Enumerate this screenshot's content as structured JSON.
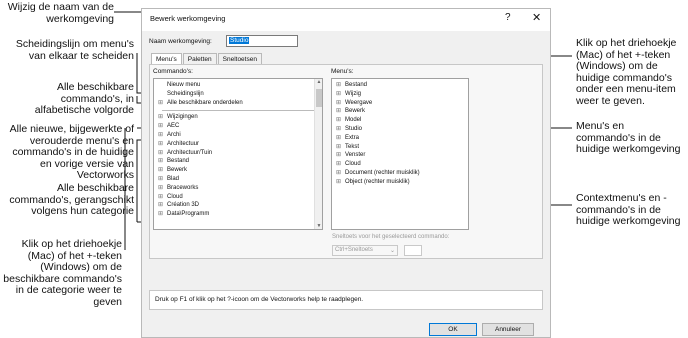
{
  "callouts": {
    "rename": "Wijzig de naam van de werkomgeving",
    "separator": "Scheidingslijn om menu's van elkaar te scheiden",
    "all_commands": "Alle beschikbare commando's, in alfabetische volgorde",
    "new_changed": "Alle nieuwe, bijgewerkte of verouderde menu's en commando's in de huidige en vorige versie van Vectorworks",
    "by_category": "Alle beschikbare commando's, gerangschikt volgens hun categorie",
    "triangle_left": "Klik op het driehoekje (Mac) of het +-teken (Windows) om de beschikbare commando's in de categorie weer te geven",
    "triangle_right": "Klik op het driehoekje (Mac) of het +-teken (Windows) om de huidige commando's onder een menu-item weer te geven.",
    "menus_commands": "Menu's en commando's in de huidige werkomgeving",
    "context_menus": "Contextmenu's en -commando's in de huidige werkomgeving"
  },
  "dialog": {
    "title": "Bewerk werkomgeving",
    "help_icon": "?",
    "close_icon": "✕",
    "name_label": "Naam werkomgeving:",
    "name_value": "Studio",
    "tabs": [
      "Menu's",
      "Paletten",
      "Sneltoetsen"
    ],
    "commands_caption": "Commando's:",
    "menus_caption": "Menu's:",
    "commands": [
      {
        "tw": "",
        "label": "Nieuw menu"
      },
      {
        "tw": "",
        "label": "Scheidingslijn"
      },
      {
        "tw": "⊞",
        "label": "Alle beschikbare onderdelen"
      },
      {
        "divider": true
      },
      {
        "tw": "⊞",
        "label": "Wijzigingen"
      },
      {
        "tw": "⊞",
        "label": "AEC"
      },
      {
        "tw": "⊞",
        "label": "Archi"
      },
      {
        "tw": "⊞",
        "label": "Architectuur"
      },
      {
        "tw": "⊞",
        "label": "Architectuur/Tuin"
      },
      {
        "tw": "⊞",
        "label": "Bestand"
      },
      {
        "tw": "⊞",
        "label": "Bewerk"
      },
      {
        "tw": "⊞",
        "label": "Blad"
      },
      {
        "tw": "⊞",
        "label": "Braceworks"
      },
      {
        "tw": "⊞",
        "label": "Cloud"
      },
      {
        "tw": "⊞",
        "label": "Création 3D"
      },
      {
        "tw": "⊞",
        "label": "Data\\Programm"
      }
    ],
    "menus": [
      {
        "tw": "⊞",
        "label": "Bestand"
      },
      {
        "tw": "⊞",
        "label": "Wijzig"
      },
      {
        "tw": "⊞",
        "label": "Weergave"
      },
      {
        "tw": "⊞",
        "label": "Bewerk"
      },
      {
        "tw": "⊞",
        "label": "Model"
      },
      {
        "tw": "⊞",
        "label": "Studio"
      },
      {
        "tw": "⊞",
        "label": "Extra"
      },
      {
        "tw": "⊞",
        "label": "Tekst"
      },
      {
        "tw": "⊞",
        "label": "Venster"
      },
      {
        "tw": "⊞",
        "label": "Cloud"
      },
      {
        "tw": "⊞",
        "label": "Document (rechter muisklik)"
      },
      {
        "tw": "⊞",
        "label": "Object (rechter muisklik)"
      }
    ],
    "shortcut_label": "Sneltoets voor het geselecteerd commando:",
    "shortcut_value": "Ctrl+Sneltoets",
    "help_text": "Druk op F1 of klik op het ?-icoon om de Vectorworks help te raadplegen.",
    "ok_label": "OK",
    "cancel_label": "Annuleer"
  }
}
